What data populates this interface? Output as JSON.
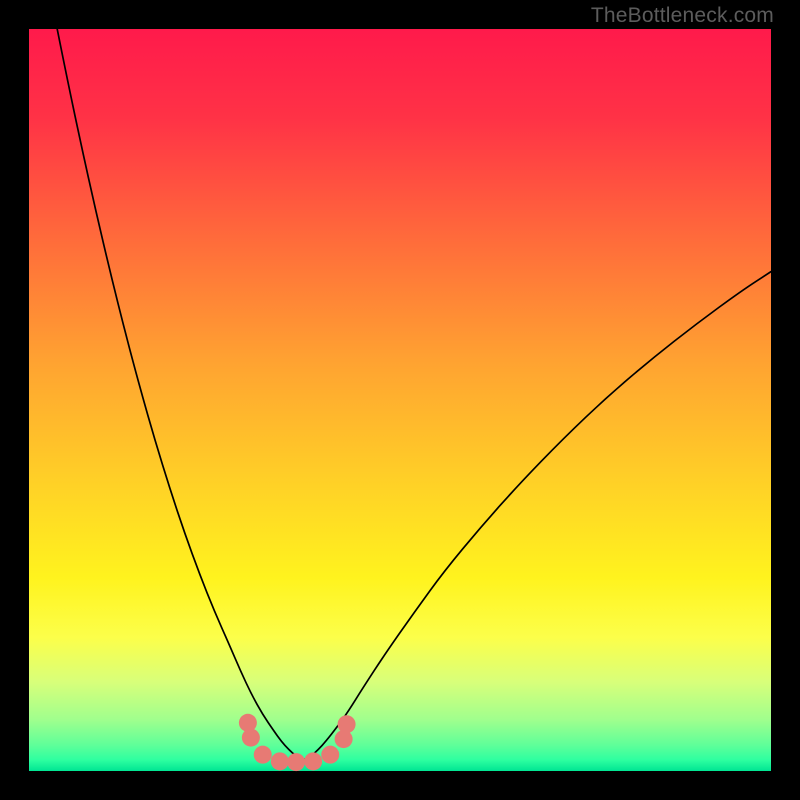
{
  "watermark": "TheBottleneck.com",
  "chart_data": {
    "type": "line",
    "title": "",
    "xlabel": "",
    "ylabel": "",
    "xlim": [
      0,
      100
    ],
    "ylim": [
      0,
      100
    ],
    "grid": false,
    "legend": false,
    "background_gradient": [
      {
        "stop": 0.0,
        "color": "#ff1a4b"
      },
      {
        "stop": 0.12,
        "color": "#ff3246"
      },
      {
        "stop": 0.28,
        "color": "#ff6a3b"
      },
      {
        "stop": 0.45,
        "color": "#ffa331"
      },
      {
        "stop": 0.62,
        "color": "#ffd326"
      },
      {
        "stop": 0.74,
        "color": "#fff31e"
      },
      {
        "stop": 0.82,
        "color": "#fcff4a"
      },
      {
        "stop": 0.88,
        "color": "#d8ff7a"
      },
      {
        "stop": 0.93,
        "color": "#a1ff8d"
      },
      {
        "stop": 0.965,
        "color": "#5fff99"
      },
      {
        "stop": 0.985,
        "color": "#2effa0"
      },
      {
        "stop": 1.0,
        "color": "#00e593"
      }
    ],
    "series": [
      {
        "name": "left-branch",
        "color": "#000000",
        "width": 1.7,
        "x": [
          3.8,
          5,
          7,
          9,
          11,
          13,
          15,
          17,
          19,
          21,
          23,
          25,
          27,
          28.5,
          30,
          31.5,
          33,
          34,
          35,
          36,
          37
        ],
        "y": [
          100,
          94,
          84.5,
          75.5,
          67,
          59,
          51.5,
          44.5,
          38,
          32,
          26.5,
          21.5,
          17,
          13.5,
          10.3,
          7.6,
          5.4,
          4.0,
          2.9,
          2.0,
          1.5
        ]
      },
      {
        "name": "right-branch",
        "color": "#000000",
        "width": 1.7,
        "x": [
          37,
          38,
          39,
          40,
          41.5,
          43,
          45,
          48,
          52,
          56,
          61,
          66,
          72,
          78,
          84,
          90,
          96,
          100
        ],
        "y": [
          1.5,
          2.0,
          2.9,
          4.0,
          5.9,
          8.0,
          11.2,
          15.8,
          21.5,
          27.0,
          33.0,
          38.6,
          44.8,
          50.5,
          55.6,
          60.3,
          64.7,
          67.3
        ]
      },
      {
        "name": "bottom-dots",
        "type": "scatter",
        "color": "#e77a74",
        "radius": 9,
        "points": [
          {
            "x": 29.5,
            "y": 6.5
          },
          {
            "x": 29.9,
            "y": 4.5
          },
          {
            "x": 31.5,
            "y": 2.2
          },
          {
            "x": 33.8,
            "y": 1.3
          },
          {
            "x": 36.0,
            "y": 1.2
          },
          {
            "x": 38.3,
            "y": 1.3
          },
          {
            "x": 40.6,
            "y": 2.2
          },
          {
            "x": 42.4,
            "y": 4.3
          },
          {
            "x": 42.8,
            "y": 6.3
          }
        ]
      }
    ]
  }
}
